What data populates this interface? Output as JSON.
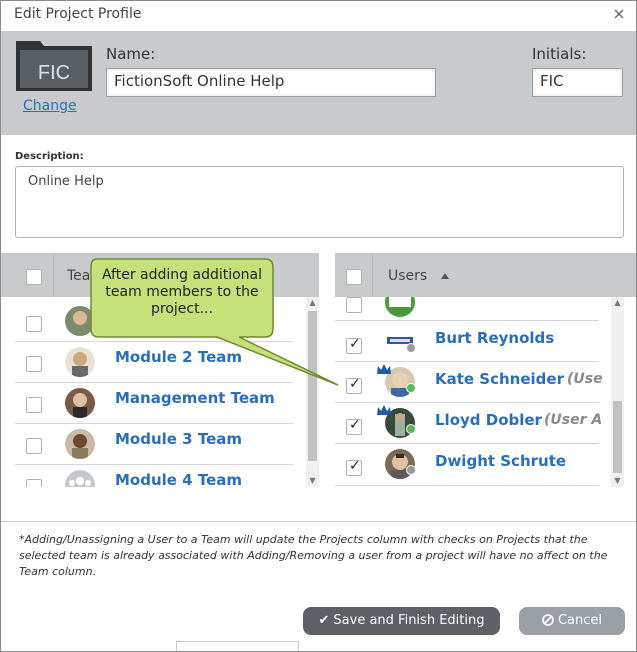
{
  "dialog": {
    "title": "Edit Project Profile",
    "close_icon": "close-icon"
  },
  "header": {
    "folder_text": "FIC",
    "change_link": "Change",
    "name_label": "Name:",
    "name_value": "FictionSoft Online Help",
    "initials_label": "Initials:",
    "initials_value": "FIC"
  },
  "description": {
    "label": "Description:",
    "value": "Online Help"
  },
  "teams": {
    "header": "Tea",
    "rows": [
      {
        "name": "",
        "checked": false
      },
      {
        "name": "Module 2 Team",
        "checked": false
      },
      {
        "name": "Management Team",
        "checked": false
      },
      {
        "name": "Module 3 Team",
        "checked": false
      },
      {
        "name": "Module 4 Team",
        "checked": false
      }
    ]
  },
  "users": {
    "header": "Users",
    "sort_icon": "sort-ascending-icon",
    "rows": [
      {
        "name": "",
        "role": "",
        "checked": false
      },
      {
        "name": "Burt Reynolds",
        "role": "",
        "checked": true
      },
      {
        "name": "Kate Schneider",
        "role": "(Use",
        "checked": true
      },
      {
        "name": "Lloyd Dobler",
        "role": "(User A",
        "checked": true
      },
      {
        "name": "Dwight Schrute",
        "role": "",
        "checked": true
      }
    ]
  },
  "callout": {
    "line1": "After adding additional",
    "line2": "team members to the",
    "line3": "project..."
  },
  "note": "*Adding/Unassigning a User to a Team will update the Projects column with checks on Projects that the selected team is already associated with Adding/Removing a user from a project will have no affect on the Team column.",
  "buttons": {
    "save": "Save and Finish Editing",
    "cancel": "Cancel"
  },
  "colors": {
    "header_bg": "#c8cacc",
    "link": "#2a6ebb",
    "callout_fill": "#c6e07a",
    "save_bg": "#5d6166",
    "cancel_bg": "#9aa0a6"
  }
}
